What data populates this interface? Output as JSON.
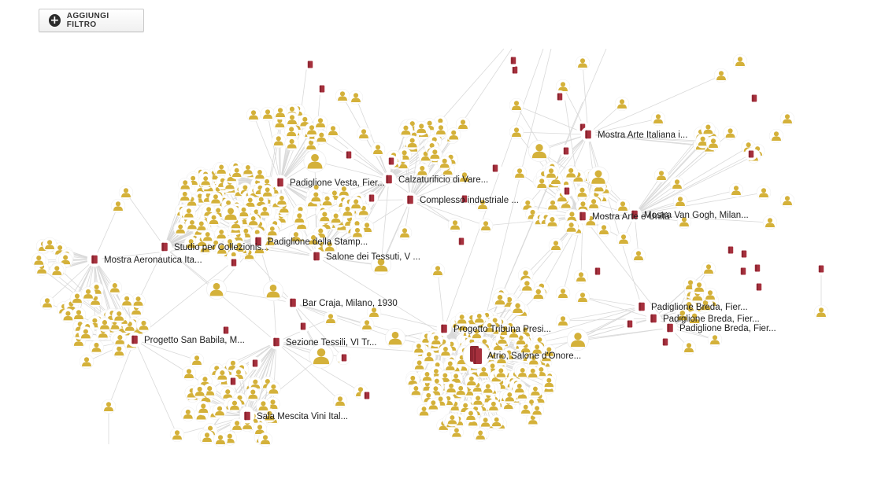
{
  "toolbar": {
    "add_filter_label": "AGGIUNGI FILTRO",
    "add_filter_icon": "plus-circle-icon"
  },
  "colors": {
    "person": "#d4b13a",
    "place": "#a6303d",
    "edge": "#d9d9d9",
    "halo": "#ffffff"
  },
  "graph": {
    "hubs": [
      {
        "id": "aeronautica",
        "label": "Mostra Aeronautica Ita..."
      },
      {
        "id": "studio",
        "label": "Studio per Collezionis..."
      },
      {
        "id": "vesta",
        "label": "Padiglione Vesta, Fier..."
      },
      {
        "id": "stampa",
        "label": "Padiglione della Stamp..."
      },
      {
        "id": "tessuti",
        "label": "Salone dei Tessuti, V ..."
      },
      {
        "id": "calzaturificio",
        "label": "Calzaturificio di Vare..."
      },
      {
        "id": "complesso",
        "label": "Complesso industriale ..."
      },
      {
        "id": "arteitaliana",
        "label": "Mostra Arte Italiana i..."
      },
      {
        "id": "arteeunita",
        "label": "Mostra Arte e Unità"
      },
      {
        "id": "vangogh",
        "label": "Mostra Van Gogh, Milan..."
      },
      {
        "id": "craja",
        "label": "Bar Craja, Milano, 1930"
      },
      {
        "id": "sanbabila",
        "label": "Progetto San Babila, M..."
      },
      {
        "id": "tessili",
        "label": "Sezione Tessili, VI Tr..."
      },
      {
        "id": "tribuna",
        "label": "Progetto Tribuna Presi..."
      },
      {
        "id": "atrio",
        "label": "Atrio, Salone d'Onore..."
      },
      {
        "id": "breda1",
        "label": "Padiglione Breda, Fier..."
      },
      {
        "id": "breda2",
        "label": "Padiglione Breda, Fier..."
      },
      {
        "id": "breda3",
        "label": "Padiglione Breda, Fier..."
      },
      {
        "id": "mescita",
        "label": "Sala Mescita Vini Ital..."
      }
    ]
  }
}
